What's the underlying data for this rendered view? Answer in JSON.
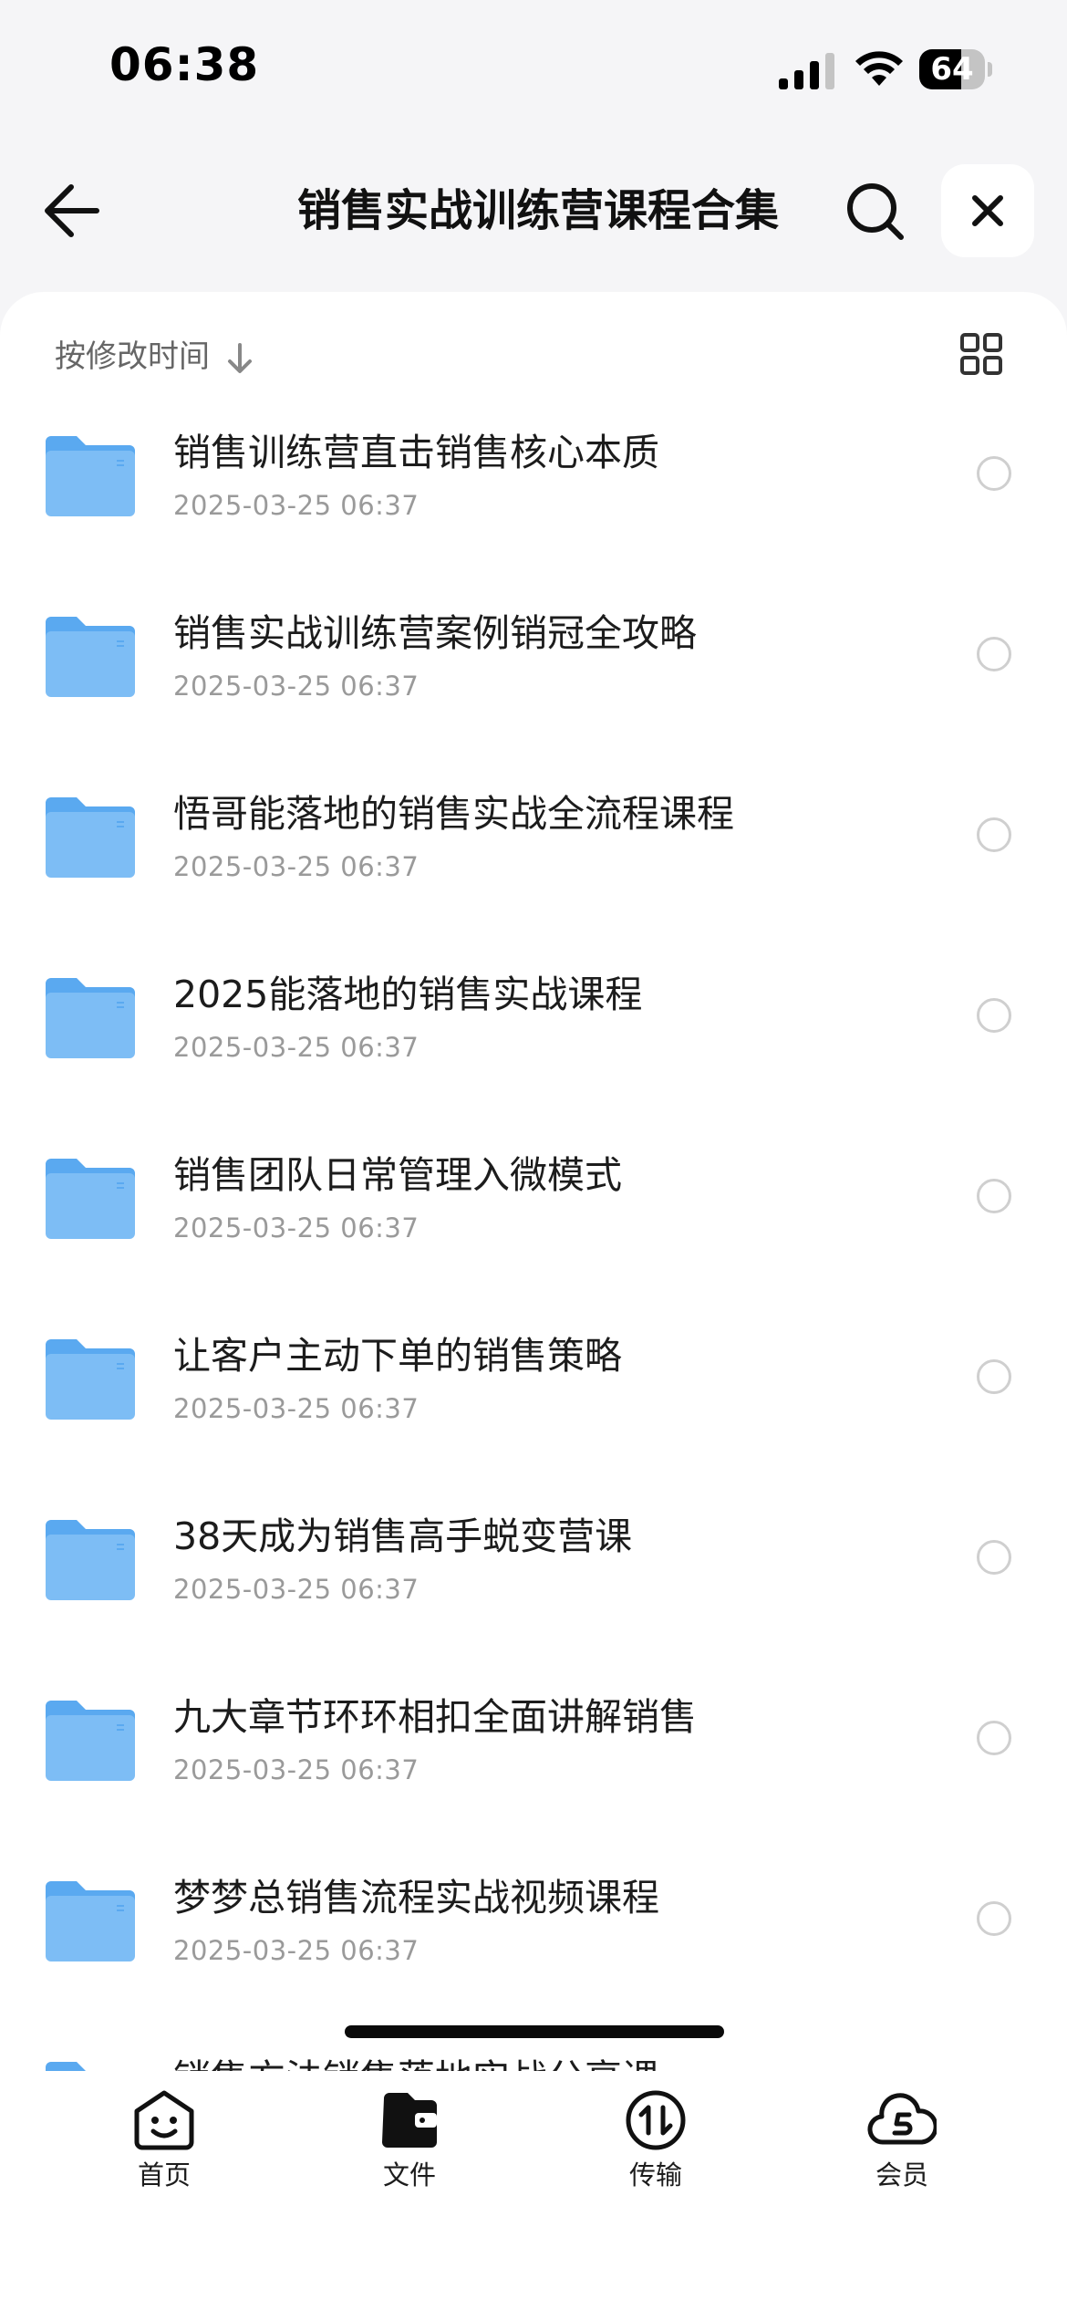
{
  "status_bar": {
    "time": "06:38",
    "battery": "64",
    "battery_level": 0.64
  },
  "nav": {
    "title": "销售实战训练营课程合集"
  },
  "toolbar": {
    "sort_label": "按修改时间"
  },
  "files": [
    {
      "name": "销售训练营直击销售核心本质",
      "date": "2025-03-25 06:37"
    },
    {
      "name": "销售实战训练营案例销冠全攻略",
      "date": "2025-03-25 06:37"
    },
    {
      "name": "悟哥能落地的销售实战全流程课程",
      "date": "2025-03-25 06:37"
    },
    {
      "name": "2025能落地的销售实战课程",
      "date": "2025-03-25 06:37"
    },
    {
      "name": "销售团队日常管理入微模式",
      "date": "2025-03-25 06:37"
    },
    {
      "name": "让客户主动下单的销售策略",
      "date": "2025-03-25 06:37"
    },
    {
      "name": "38天成为销售高手蜕变营课",
      "date": "2025-03-25 06:37"
    },
    {
      "name": "九大章节环环相扣全面讲解销售",
      "date": "2025-03-25 06:37"
    },
    {
      "name": "梦梦总销售流程实战视频课程",
      "date": "2025-03-25 06:37"
    },
    {
      "name": "销售方法销售落地实战分享课",
      "date": ""
    }
  ],
  "tabs": [
    {
      "label": "首页",
      "icon": "home-face-icon"
    },
    {
      "label": "文件",
      "icon": "files-wallet-icon",
      "active": true
    },
    {
      "label": "传输",
      "icon": "transfer-icon"
    },
    {
      "label": "会员",
      "icon": "member-cloud-icon"
    }
  ],
  "colors": {
    "folder": "#5aa9f0",
    "accent": "#1a1a1a"
  }
}
